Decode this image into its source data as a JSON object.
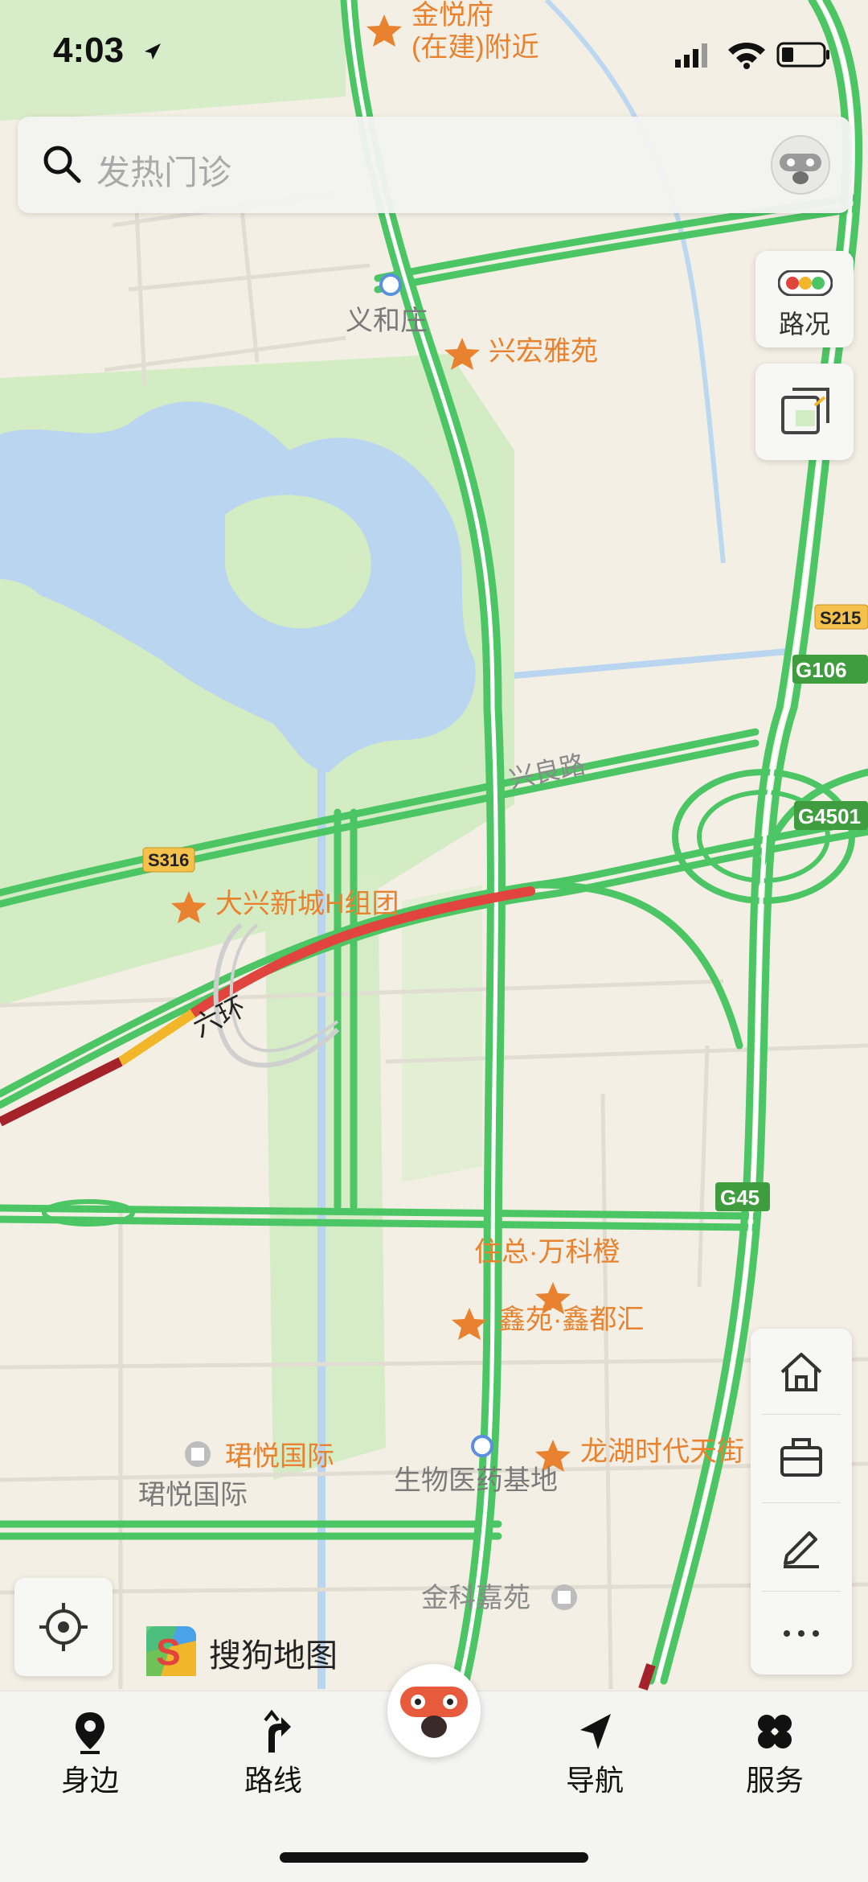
{
  "status": {
    "time": "4:03"
  },
  "search": {
    "placeholder": "发热门诊"
  },
  "controls": {
    "traffic_label": "路况"
  },
  "map": {
    "labels": {
      "jinyuefu_line1": "金悦府",
      "jinyuefu_line2": "(在建)附近",
      "yihezhuang": "义和庄",
      "xinghongyayuan": "兴宏雅苑",
      "xingliang_road": "兴良路",
      "daxing_h": "大兴新城H组团",
      "liuhuan": "六环",
      "zhuzong_wanke": "住总·万科橙",
      "xinyuan": "鑫苑·鑫都汇",
      "junyue_1": "珺悦国际",
      "junyue_2": "珺悦国际",
      "shengwu": "生物医药基地",
      "longhu": "龙湖时代天街",
      "jinke": "金科嘉苑"
    },
    "shields": {
      "s215": "S215",
      "g106": "G106",
      "g4501": "G4501",
      "s316": "S316",
      "g45": "G45"
    }
  },
  "brand": {
    "name": "搜狗地图"
  },
  "nav": {
    "nearby": "身边",
    "route": "路线",
    "navigate": "导航",
    "services": "服务"
  },
  "colors": {
    "road_green": "#4cc564",
    "congested_red": "#e0443c",
    "heavy_red": "#a4232a",
    "slow_yellow": "#f2b62b",
    "water": "#b9d5f0",
    "park": "#d3ecc4",
    "poi_orange": "#e9822e"
  }
}
